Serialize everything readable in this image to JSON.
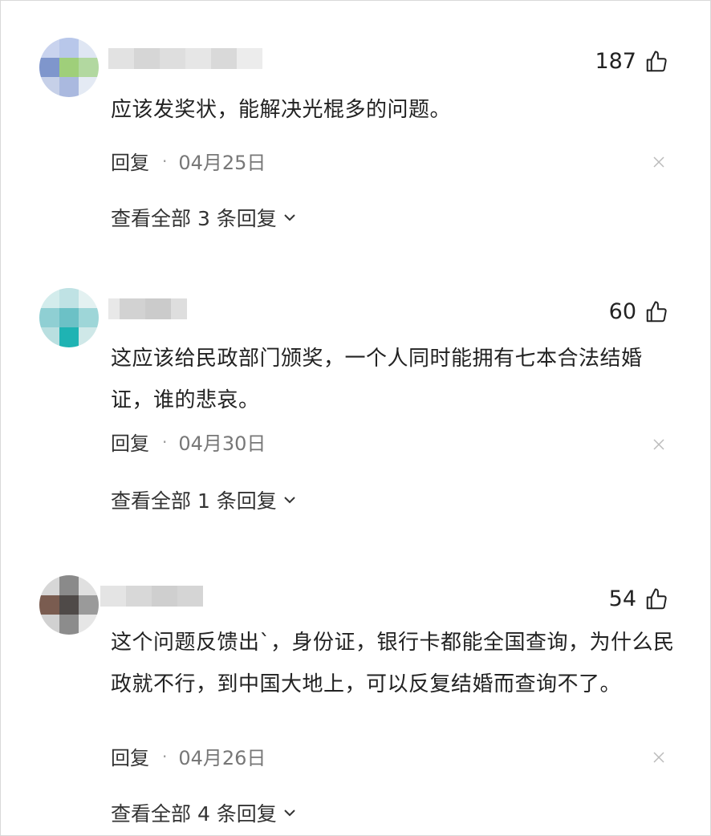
{
  "colors": {
    "text": "#222222",
    "meta": "#777777",
    "close": "#bbbbbb"
  },
  "comments": [
    {
      "likes": "187",
      "content": "应该发奖状，能解决光棍多的问题。",
      "reply_label": "回复",
      "separator": "·",
      "date": "04月25日",
      "view_replies": "查看全部 3 条回复"
    },
    {
      "likes": "60",
      "content": "这应该给民政部门颁奖，一个人同时能拥有七本合法结婚证，谁的悲哀。",
      "reply_label": "回复",
      "separator": "·",
      "date": "04月30日",
      "view_replies": "查看全部 1 条回复"
    },
    {
      "likes": "54",
      "content": "这个问题反馈出`，身份证，银行卡都能全国查询，为什么民政就不行，到中国大地上，可以反复结婚而查询不了。",
      "reply_label": "回复",
      "separator": "·",
      "date": "04月26日",
      "view_replies": "查看全部 4 条回复"
    }
  ],
  "icons": {
    "like": "thumbs-up-icon",
    "close": "close-icon",
    "expand": "chevron-down-icon"
  }
}
